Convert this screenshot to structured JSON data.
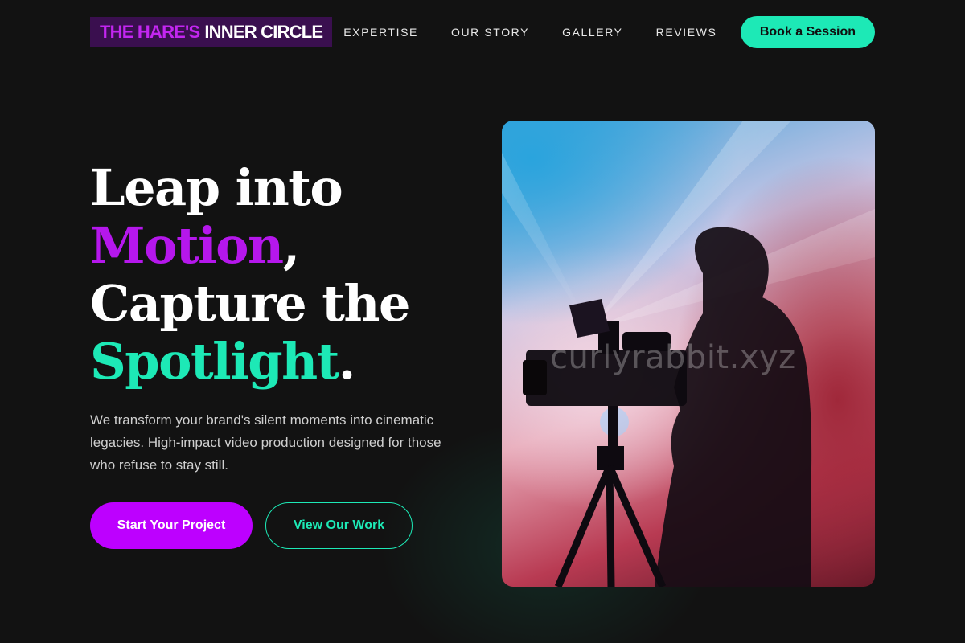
{
  "brand": {
    "name_part1": "THE HARE'S",
    "name_part2": "INNER CIRCLE"
  },
  "nav": {
    "links": [
      "EXPERTISE",
      "OUR STORY",
      "GALLERY",
      "REVIEWS"
    ],
    "cta_label": "Book a Session"
  },
  "hero": {
    "headline": {
      "line1": "Leap into",
      "word_purple": "Motion",
      "comma": ",",
      "line3": "Capture the",
      "word_teal": "Spotlight",
      "period": "."
    },
    "subtext": "We transform your brand's silent moments into cinematic legacies. High-impact video production designed for those who refuse to stay still.",
    "primary_button": "Start Your Project",
    "secondary_button": "View Our Work",
    "image": {
      "subject": "videographer-with-camera-on-tripod",
      "watermark": "curlyrabbit.xyz"
    }
  },
  "colors": {
    "background": "#121212",
    "accent_purple": "#bd00ff",
    "accent_teal": "#1de9b6",
    "logo_bg": "#3a0f4f"
  }
}
